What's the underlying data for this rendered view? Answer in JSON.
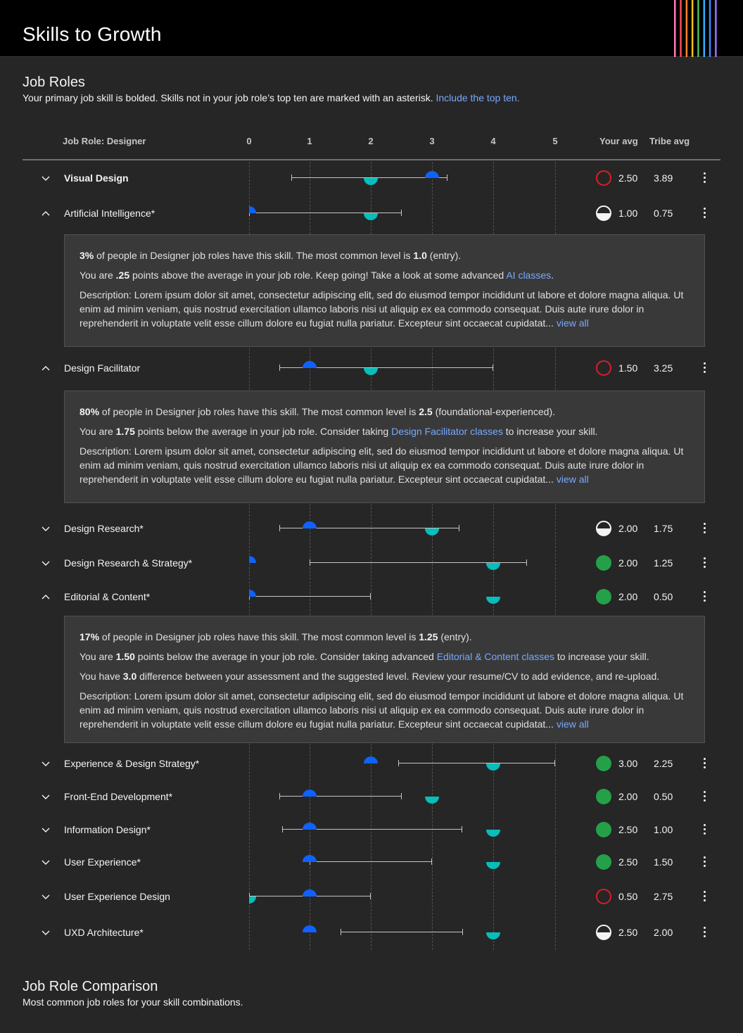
{
  "app": {
    "title": "Skills to Growth"
  },
  "job_roles": {
    "title": "Job Roles",
    "subtitle": "Your primary job skill is bolded. Skills not in your job role’s top ten are marked with an asterisk.",
    "subtitle_link": "Include the top ten."
  },
  "table": {
    "role_header": "Job Role: Designer",
    "ticks": [
      "0",
      "1",
      "2",
      "3",
      "4",
      "5"
    ],
    "your_avg_header": "Your avg",
    "tribe_avg_header": "Tribe avg"
  },
  "skills": [
    {
      "name": "Visual Design",
      "primary": true,
      "expanded": false,
      "you": 3.0,
      "tribe": 2.0,
      "range": [
        0.7,
        3.25
      ],
      "status": "empty",
      "your_avg": "2.50",
      "tribe_avg": "3.89"
    },
    {
      "name": "Artificial Intelligence*",
      "expanded": true,
      "you": 0.0,
      "tribe": 2.0,
      "range": [
        0.0,
        2.5
      ],
      "status": "half",
      "your_avg": "1.00",
      "tribe_avg": "0.75"
    },
    {
      "name": "Design Facilitator",
      "expanded": true,
      "you": 1.0,
      "tribe": 2.0,
      "range": [
        0.5,
        4.0
      ],
      "status": "empty",
      "your_avg": "1.50",
      "tribe_avg": "3.25"
    },
    {
      "name": "Design Research*",
      "expanded": false,
      "you": 1.0,
      "tribe": 3.0,
      "range": [
        0.5,
        3.45
      ],
      "status": "half",
      "your_avg": "2.00",
      "tribe_avg": "1.75"
    },
    {
      "name": "Design Research & Strategy*",
      "expanded": false,
      "you": 0.0,
      "tribe": 4.0,
      "range": [
        1.0,
        4.55
      ],
      "status": "full",
      "your_avg": "2.00",
      "tribe_avg": "1.25"
    },
    {
      "name": "Editorial & Content*",
      "expanded": true,
      "you": 0.0,
      "tribe": 4.0,
      "range": [
        0.0,
        2.0
      ],
      "status": "full",
      "your_avg": "2.00",
      "tribe_avg": "0.50"
    },
    {
      "name": "Experience & Design Strategy*",
      "expanded": false,
      "you": 2.0,
      "tribe": 4.0,
      "range": [
        2.45,
        5.0
      ],
      "status": "full",
      "your_avg": "3.00",
      "tribe_avg": "2.25"
    },
    {
      "name": "Front-End Development*",
      "expanded": false,
      "you": 1.0,
      "tribe": 3.0,
      "range": [
        0.5,
        2.5
      ],
      "status": "full",
      "your_avg": "2.00",
      "tribe_avg": "0.50"
    },
    {
      "name": "Information Design*",
      "expanded": false,
      "you": 1.0,
      "tribe": 4.0,
      "range": [
        0.55,
        3.5
      ],
      "status": "full",
      "your_avg": "2.50",
      "tribe_avg": "1.00"
    },
    {
      "name": "User Experience*",
      "expanded": false,
      "you": 1.0,
      "tribe": 4.0,
      "range": [
        1.0,
        3.0
      ],
      "status": "full",
      "your_avg": "2.50",
      "tribe_avg": "1.50"
    },
    {
      "name": "User Experience Design",
      "expanded": false,
      "you": 1.0,
      "tribe": 0.0,
      "range": [
        0.0,
        2.0
      ],
      "status": "empty",
      "your_avg": "0.50",
      "tribe_avg": "2.75"
    },
    {
      "name": "UXD Architecture*",
      "expanded": false,
      "you": 1.0,
      "tribe": 4.0,
      "range": [
        1.5,
        3.5
      ],
      "status": "half",
      "your_avg": "2.50",
      "tribe_avg": "2.00"
    }
  ],
  "details": {
    "ai": {
      "p1_pct": "3%",
      "p1_a": " of people in Designer job roles have this skill. The most common level is ",
      "p1_lvl": "1.0",
      "p1_b": " (entry).",
      "p2_a": "You are ",
      "p2_num": ".25",
      "p2_b": " points above the average in your job role. Keep going! Take a look at some advanced ",
      "p2_link": "AI classes",
      "p2_c": ".",
      "desc": "Description: Lorem ipsum dolor sit amet, consectetur adipiscing elit, sed do eiusmod tempor incididunt ut labore et dolore magna aliqua. Ut enim ad minim veniam, quis nostrud exercitation ullamco laboris nisi ut aliquip ex ea commodo consequat. Duis aute irure dolor in reprehenderit in voluptate velit esse cillum dolore eu fugiat nulla pariatur. Excepteur sint occaecat cupidatat...",
      "view_all": "view all"
    },
    "facilitator": {
      "p1_pct": "80%",
      "p1_a": " of people in Designer job roles have this skill. The most common level is ",
      "p1_lvl": "2.5",
      "p1_b": " (foundational-experienced).",
      "p2_a": "You are ",
      "p2_num": "1.75",
      "p2_b": " points below the average in your job role. Consider taking ",
      "p2_link": "Design Facilitator classes",
      "p2_c": " to increase your skill.",
      "desc": "Description: Lorem ipsum dolor sit amet, consectetur adipiscing elit, sed do eiusmod tempor incididunt ut labore et dolore magna aliqua. Ut enim ad minim veniam, quis nostrud exercitation ullamco laboris nisi ut aliquip ex ea commodo consequat. Duis aute irure dolor in reprehenderit in voluptate velit esse cillum dolore eu fugiat nulla pariatur. Excepteur sint occaecat cupidatat...",
      "view_all": "view all"
    },
    "editorial": {
      "p1_pct": "17%",
      "p1_a": " of people in Designer job roles have this skill. The most common level is ",
      "p1_lvl": "1.25",
      "p1_b": " (entry).",
      "p2_a": "You are ",
      "p2_num": "1.50",
      "p2_b": " points below the average in your job role. Consider taking advanced ",
      "p2_link": "Editorial & Content classes",
      "p2_c": " to increase your skill.",
      "p3_a": "You have ",
      "p3_num": "3.0",
      "p3_b": " difference between your assessment and the suggested level. Review your resume/CV to add evidence, and re-upload.",
      "desc": "Description: Lorem ipsum dolor sit amet, consectetur adipiscing elit, sed do eiusmod tempor incididunt ut labore et dolore magna aliqua. Ut enim ad minim veniam, quis nostrud exercitation ullamco laboris nisi ut aliquip ex ea commodo consequat. Duis aute irure dolor in reprehenderit in voluptate velit esse cillum dolore eu fugiat nulla pariatur. Excepteur sint occaecat cupidatat...",
      "view_all": "view all"
    }
  },
  "comparison": {
    "title": "Job Role Comparison",
    "subtitle": "Most common job roles for your skill combinations."
  },
  "colors": {
    "you": "#0f62fe",
    "tribe": "#08bdba",
    "link": "#78a9ff",
    "status_below": "#da1e28",
    "status_above": "#24a148",
    "stripes": [
      "#ff7eb6",
      "#fa4d56",
      "#ff832b",
      "#f1c21b",
      "#42be65",
      "#33b1ff",
      "#4589ff",
      "#a56eff"
    ]
  }
}
